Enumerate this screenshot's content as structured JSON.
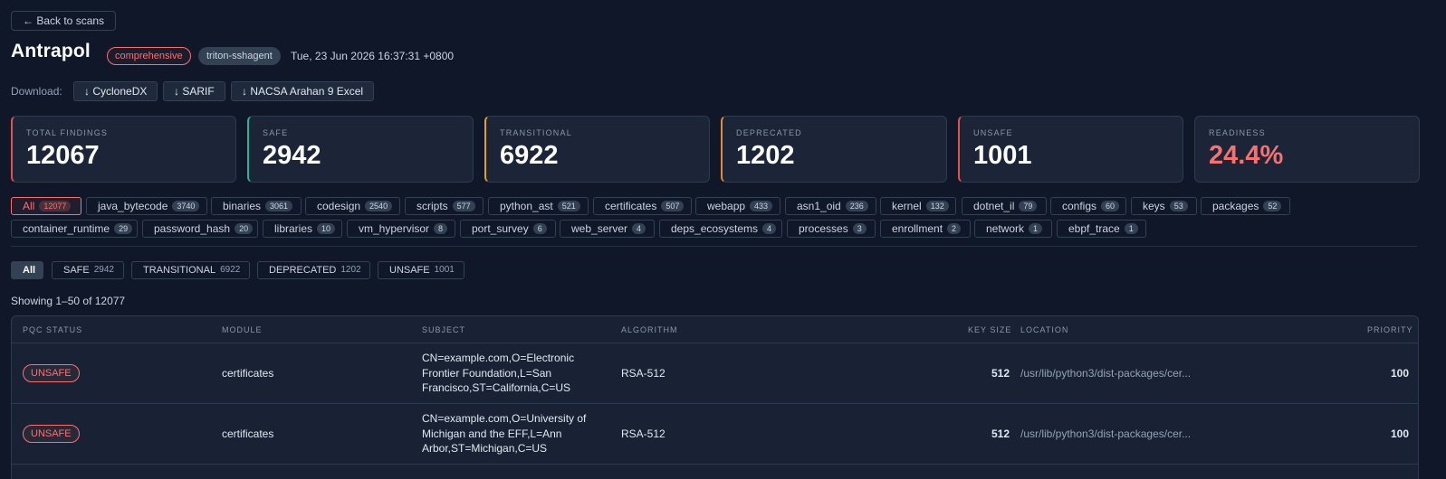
{
  "back": {
    "label": "← Back to scans"
  },
  "header": {
    "title": "Antrapol",
    "profile_badge": "comprehensive",
    "agent_badge": "triton-sshagent",
    "timestamp": "Tue, 23 Jun 2026 16:37:31 +0800"
  },
  "download": {
    "label": "Download:",
    "buttons": [
      "↓ CycloneDX",
      "↓ SARIF",
      "↓ NACSA Arahan 9 Excel"
    ]
  },
  "stats": [
    {
      "label": "TOTAL FINDINGS",
      "value": "12067",
      "accent": "#e05252"
    },
    {
      "label": "SAFE",
      "value": "2942",
      "accent": "#2bb39a"
    },
    {
      "label": "TRANSITIONAL",
      "value": "6922",
      "accent": "#e0a020"
    },
    {
      "label": "DEPRECATED",
      "value": "1202",
      "accent": "#e08a3a"
    },
    {
      "label": "UNSAFE",
      "value": "1001",
      "accent": "#e05252"
    },
    {
      "label": "READINESS",
      "value": "24.4%",
      "accent": "#f87171"
    }
  ],
  "modules": [
    {
      "label": "All",
      "count": "12077"
    },
    {
      "label": "java_bytecode",
      "count": "3740"
    },
    {
      "label": "binaries",
      "count": "3061"
    },
    {
      "label": "codesign",
      "count": "2540"
    },
    {
      "label": "scripts",
      "count": "577"
    },
    {
      "label": "python_ast",
      "count": "521"
    },
    {
      "label": "certificates",
      "count": "507"
    },
    {
      "label": "webapp",
      "count": "433"
    },
    {
      "label": "asn1_oid",
      "count": "236"
    },
    {
      "label": "kernel",
      "count": "132"
    },
    {
      "label": "dotnet_il",
      "count": "79"
    },
    {
      "label": "configs",
      "count": "60"
    },
    {
      "label": "keys",
      "count": "53"
    },
    {
      "label": "packages",
      "count": "52"
    },
    {
      "label": "container_runtime",
      "count": "29"
    },
    {
      "label": "password_hash",
      "count": "20"
    },
    {
      "label": "libraries",
      "count": "10"
    },
    {
      "label": "vm_hypervisor",
      "count": "8"
    },
    {
      "label": "port_survey",
      "count": "6"
    },
    {
      "label": "web_server",
      "count": "4"
    },
    {
      "label": "deps_ecosystems",
      "count": "4"
    },
    {
      "label": "processes",
      "count": "3"
    },
    {
      "label": "enrollment",
      "count": "2"
    },
    {
      "label": "network",
      "count": "1"
    },
    {
      "label": "ebpf_trace",
      "count": "1"
    }
  ],
  "status_filters": [
    {
      "label": "All",
      "count": ""
    },
    {
      "label": "SAFE",
      "count": "2942"
    },
    {
      "label": "TRANSITIONAL",
      "count": "6922"
    },
    {
      "label": "DEPRECATED",
      "count": "1202"
    },
    {
      "label": "UNSAFE",
      "count": "1001"
    }
  ],
  "showing": "Showing 1–50 of 12077",
  "table": {
    "columns": [
      "PQC STATUS",
      "MODULE",
      "SUBJECT",
      "ALGORITHM",
      "KEY SIZE",
      "LOCATION",
      "PRIORITY"
    ],
    "rows": [
      {
        "status": "UNSAFE",
        "module": "certificates",
        "subject": [
          "CN=example.com,O=Electronic",
          "Frontier Foundation,L=San",
          "Francisco,ST=California,C=US"
        ],
        "algorithm": "RSA-512",
        "key_size": "512",
        "location": "/usr/lib/python3/dist-packages/cer...",
        "priority": "100"
      },
      {
        "status": "UNSAFE",
        "module": "certificates",
        "subject": [
          "CN=example.com,O=University of",
          "Michigan and the EFF,L=Ann",
          "Arbor,ST=Michigan,C=US"
        ],
        "algorithm": "RSA-512",
        "key_size": "512",
        "location": "/usr/lib/python3/dist-packages/cer...",
        "priority": "100"
      }
    ]
  }
}
